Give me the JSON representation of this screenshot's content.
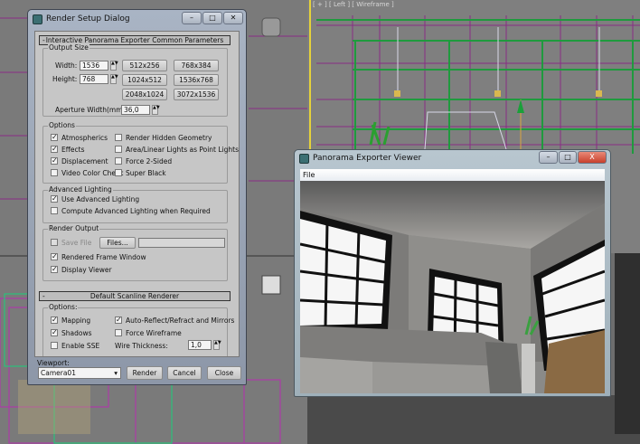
{
  "viewport_label": "[ + ] [ Left ] [ Wireframe ]",
  "render_dialog": {
    "title": "Render Setup Dialog",
    "window_buttons": [
      "minimize",
      "maximize",
      "close"
    ],
    "rollout1": "Interactive Panorama Exporter Common Parameters",
    "collapse_symbol": "-",
    "output_size": {
      "label": "Output Size",
      "width_label": "Width:",
      "width": "1536",
      "height_label": "Height:",
      "height": "768",
      "presets": [
        "512x256",
        "768x384",
        "1024x512",
        "1536x768",
        "2048x1024",
        "3072x1536"
      ],
      "aperture_label": "Aperture Width(mm):",
      "aperture": "36,0"
    },
    "options": {
      "label": "Options",
      "items": [
        {
          "label": "Atmospherics",
          "checked": true
        },
        {
          "label": "Render Hidden Geometry",
          "checked": false
        },
        {
          "label": "Effects",
          "checked": true
        },
        {
          "label": "Area/Linear Lights as Point Lights",
          "checked": false
        },
        {
          "label": "Displacement",
          "checked": true
        },
        {
          "label": "Force 2-Sided",
          "checked": false
        },
        {
          "label": "Video Color Check",
          "checked": false
        },
        {
          "label": "Super Black",
          "checked": false
        }
      ]
    },
    "advanced_lighting": {
      "label": "Advanced Lighting",
      "items": [
        {
          "label": "Use Advanced Lighting",
          "checked": true
        },
        {
          "label": "Compute Advanced Lighting when Required",
          "checked": false
        }
      ]
    },
    "render_output": {
      "label": "Render Output",
      "save_file": "Save File",
      "files_button": "Files...",
      "file_path": "",
      "items": [
        {
          "label": "Rendered Frame Window",
          "checked": true
        },
        {
          "label": "Display Viewer",
          "checked": true
        }
      ]
    },
    "rollout2": "Default Scanline Renderer",
    "scanline_options": {
      "label": "Options:",
      "items": [
        {
          "label": "Mapping",
          "checked": true
        },
        {
          "label": "Auto-Reflect/Refract and Mirrors",
          "checked": true
        },
        {
          "label": "Shadows",
          "checked": true
        },
        {
          "label": "Force Wireframe",
          "checked": false
        },
        {
          "label": "Enable SSE",
          "checked": false
        }
      ],
      "wire_label": "Wire Thickness:",
      "wire_value": "1,0"
    },
    "viewport_label": "Viewport:",
    "viewport_value": "Camera01",
    "buttons": {
      "render": "Render",
      "cancel": "Cancel",
      "close": "Close"
    }
  },
  "viewer": {
    "title": "Panorama Exporter Viewer",
    "menu_file": "File",
    "close_symbol": "X"
  }
}
